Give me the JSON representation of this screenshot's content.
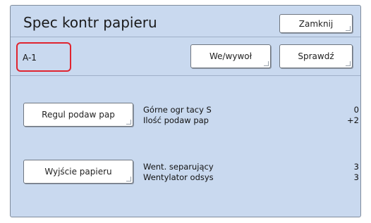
{
  "header": {
    "title": "Spec kontr papieru",
    "close_label": "Zamknij"
  },
  "toolbar": {
    "code_value": "A-1",
    "inout_label": "We/wywoł",
    "check_label": "Sprawdź"
  },
  "feed_section": {
    "button_label": "Regul podaw pap",
    "rows": [
      {
        "label": "Górne ogr tacy S",
        "value": "0"
      },
      {
        "label": "Ilość podaw pap",
        "value": "+2"
      }
    ]
  },
  "output_section": {
    "button_label": "Wyjście papieru",
    "rows": [
      {
        "label": "Went. separujący",
        "value": "3"
      },
      {
        "label": "Wentylator odsys",
        "value": "3"
      }
    ]
  },
  "colors": {
    "panel_background": "#c9d9ef",
    "highlight_border": "#e0242f"
  }
}
